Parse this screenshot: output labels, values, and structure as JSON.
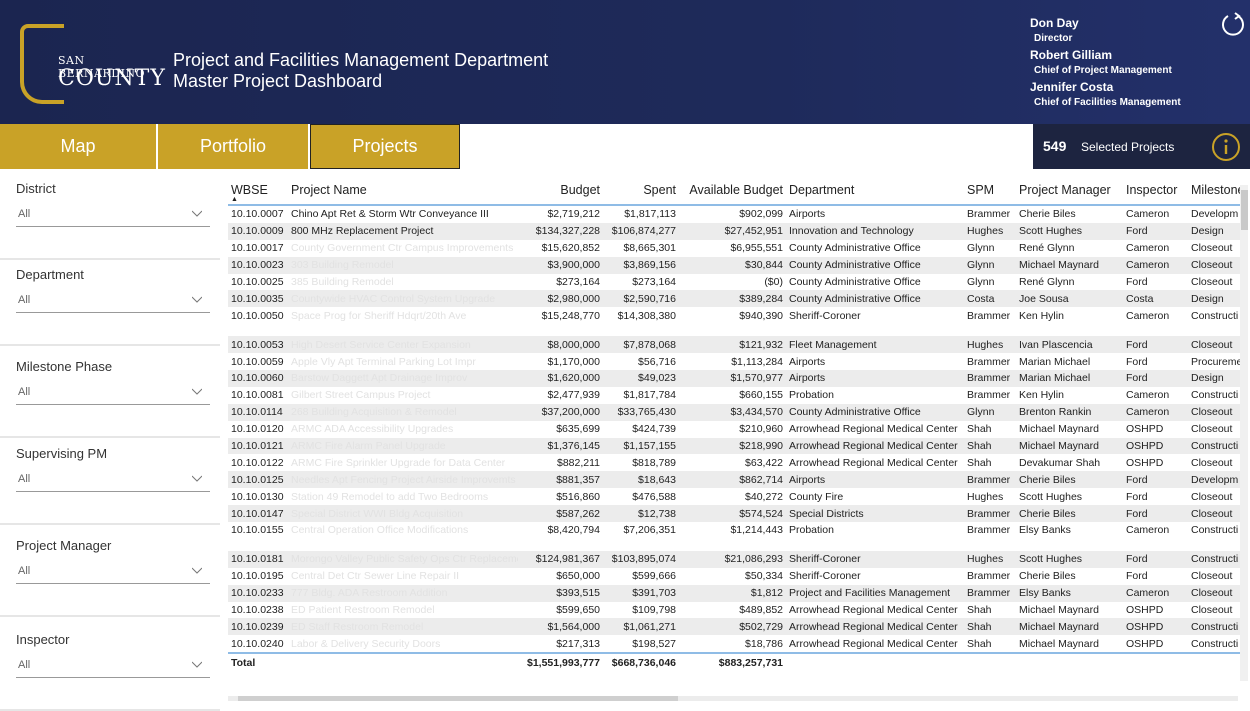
{
  "header": {
    "logo_top": "SAN BERNARDINO",
    "logo_bottom": "COUNTY",
    "title_line1": "Project and Facilities Management Department",
    "title_line2": "Master Project Dashboard",
    "staff": [
      {
        "name": "Don Day",
        "role": "Director"
      },
      {
        "name": "Robert Gilliam",
        "role": "Chief of Project Management"
      },
      {
        "name": "Jennifer Costa",
        "role": "Chief of Facilities Management"
      }
    ]
  },
  "nav": {
    "map": "Map",
    "portfolio": "Portfolio",
    "projects": "Projects"
  },
  "selection": {
    "count": "549",
    "label": "Selected Projects"
  },
  "filters": [
    {
      "label": "District",
      "value": "All"
    },
    {
      "label": "Department",
      "value": "All"
    },
    {
      "label": "Milestone Phase",
      "value": "All"
    },
    {
      "label": "Supervising PM",
      "value": "All"
    },
    {
      "label": "Project Manager",
      "value": "All"
    },
    {
      "label": "Inspector",
      "value": "All"
    }
  ],
  "table": {
    "columns": [
      "WBSE",
      "Project Name",
      "Budget",
      "Spent",
      "Available Budget",
      "Department",
      "SPM",
      "Project Manager",
      "Inspector",
      "Milestone"
    ],
    "rows": [
      [
        "10.10.0007",
        "Chino Apt Ret & Storm Wtr Conveyance III",
        "$2,719,212",
        "$1,817,113",
        "$902,099",
        "Airports",
        "Brammer",
        "Cherie Biles",
        "Cameron",
        "Developm"
      ],
      [
        "10.10.0009",
        "800 MHz Replacement Project",
        "$134,327,228",
        "$106,874,277",
        "$27,452,951",
        "Innovation and Technology",
        "Hughes",
        "Scott Hughes",
        "Ford",
        "Design"
      ],
      [
        "10.10.0017",
        "County Government Ctr Campus Improvements",
        "$15,620,852",
        "$8,665,301",
        "$6,955,551",
        "County Administrative Office",
        "Glynn",
        "René Glynn",
        "Cameron",
        "Closeout"
      ],
      [
        "10.10.0023",
        "303 Building Remodel",
        "$3,900,000",
        "$3,869,156",
        "$30,844",
        "County Administrative Office",
        "Glynn",
        "Michael Maynard",
        "Cameron",
        "Closeout"
      ],
      [
        "10.10.0025",
        "385 Building Remodel",
        "$273,164",
        "$273,164",
        "($0)",
        "County Administrative Office",
        "Glynn",
        "René Glynn",
        "Ford",
        "Closeout"
      ],
      [
        "10.10.0035",
        "Countywide HVAC Control System Upgrade",
        "$2,980,000",
        "$2,590,716",
        "$389,284",
        "County Administrative Office",
        "Costa",
        "Joe Sousa",
        "Costa",
        "Design"
      ],
      [
        "10.10.0050",
        "Space Prog for Sheriff Hdqrt/20th Ave",
        "$15,248,770",
        "$14,308,380",
        "$940,390",
        "Sheriff-Coroner",
        "Brammer",
        "Ken Hylin",
        "Cameron",
        "Constructi"
      ],
      [
        "",
        "",
        "",
        "",
        "",
        "",
        "",
        "",
        "",
        ""
      ],
      [
        "10.10.0053",
        "High Desert Service Center Expansion",
        "$8,000,000",
        "$7,878,068",
        "$121,932",
        "Fleet Management",
        "Hughes",
        "Ivan Plascencia",
        "Ford",
        "Closeout"
      ],
      [
        "10.10.0059",
        "Apple Vly Apt Terminal Parking Lot Impr",
        "$1,170,000",
        "$56,716",
        "$1,113,284",
        "Airports",
        "Brammer",
        "Marian Michael",
        "Ford",
        "Procureme"
      ],
      [
        "10.10.0060",
        "Barstow Daggett Apt Drainage Improv",
        "$1,620,000",
        "$49,023",
        "$1,570,977",
        "Airports",
        "Brammer",
        "Marian Michael",
        "Ford",
        "Design"
      ],
      [
        "10.10.0081",
        "Gilbert Street Campus Project",
        "$2,477,939",
        "$1,817,784",
        "$660,155",
        "Probation",
        "Brammer",
        "Ken Hylin",
        "Cameron",
        "Constructi"
      ],
      [
        "10.10.0114",
        "268 Building Acquisition & Remodel",
        "$37,200,000",
        "$33,765,430",
        "$3,434,570",
        "County Administrative Office",
        "Glynn",
        "Brenton Rankin",
        "Cameron",
        "Closeout"
      ],
      [
        "10.10.0120",
        "ARMC ADA Accessibility Upgrades",
        "$635,699",
        "$424,739",
        "$210,960",
        "Arrowhead Regional Medical Center",
        "Shah",
        "Michael Maynard",
        "OSHPD",
        "Closeout"
      ],
      [
        "10.10.0121",
        "ARMC Fire Alarm Panel Upgrade",
        "$1,376,145",
        "$1,157,155",
        "$218,990",
        "Arrowhead Regional Medical Center",
        "Shah",
        "Michael Maynard",
        "OSHPD",
        "Constructi"
      ],
      [
        "10.10.0122",
        "ARMC Fire Sprinkler Upgrade for Data Center",
        "$882,211",
        "$818,789",
        "$63,422",
        "Arrowhead Regional Medical Center",
        "Shah",
        "Devakumar Shah",
        "OSHPD",
        "Closeout"
      ],
      [
        "10.10.0125",
        "Needles Apt Fencing Project Airside Improvemts",
        "$881,357",
        "$18,643",
        "$862,714",
        "Airports",
        "Brammer",
        "Cherie Biles",
        "Ford",
        "Developm"
      ],
      [
        "10.10.0130",
        "Station 49 Remodel to add Two Bedrooms",
        "$516,860",
        "$476,588",
        "$40,272",
        "County Fire",
        "Hughes",
        "Scott Hughes",
        "Ford",
        "Closeout"
      ],
      [
        "10.10.0147",
        "Special District WWI Bldg Acquisition",
        "$587,262",
        "$12,738",
        "$574,524",
        "Special Districts",
        "Brammer",
        "Cherie Biles",
        "Ford",
        "Closeout"
      ],
      [
        "10.10.0155",
        "Central Operation Office Modifications",
        "$8,420,794",
        "$7,206,351",
        "$1,214,443",
        "Probation",
        "Brammer",
        "Elsy Banks",
        "Cameron",
        "Constructi"
      ],
      [
        "",
        "",
        "",
        "",
        "",
        "",
        "",
        "",
        "",
        ""
      ],
      [
        "10.10.0181",
        "Morongo Valley Public Safety Ops Ctr Replacement",
        "$124,981,367",
        "$103,895,074",
        "$21,086,293",
        "Sheriff-Coroner",
        "Hughes",
        "Scott Hughes",
        "Ford",
        "Constructi"
      ],
      [
        "10.10.0195",
        "Central Det Ctr Sewer Line Repair II",
        "$650,000",
        "$599,666",
        "$50,334",
        "Sheriff-Coroner",
        "Brammer",
        "Cherie Biles",
        "Ford",
        "Closeout"
      ],
      [
        "10.10.0233",
        "777 Bldg. ADA Restroom Addition",
        "$393,515",
        "$391,703",
        "$1,812",
        "Project and Facilities Management",
        "Brammer",
        "Elsy Banks",
        "Cameron",
        "Closeout"
      ],
      [
        "10.10.0238",
        "ED Patient Restroom Remodel",
        "$599,650",
        "$109,798",
        "$489,852",
        "Arrowhead Regional Medical Center",
        "Shah",
        "Michael Maynard",
        "OSHPD",
        "Closeout"
      ],
      [
        "10.10.0239",
        "ED Staff Restroom Remodel",
        "$1,564,000",
        "$1,061,271",
        "$502,729",
        "Arrowhead Regional Medical Center",
        "Shah",
        "Michael Maynard",
        "OSHPD",
        "Constructi"
      ],
      [
        "10.10.0240",
        "Labor & Delivery Security Doors",
        "$217,313",
        "$198,527",
        "$18,786",
        "Arrowhead Regional Medical Center",
        "Shah",
        "Michael Maynard",
        "OSHPD",
        "Constructi"
      ]
    ],
    "total": {
      "label": "Total",
      "budget": "$1,551,993,777",
      "spent": "$668,736,046",
      "available": "$883,257,731"
    }
  },
  "colors": {
    "header_bg": "#1e2a5a",
    "nav_gold": "#c9a227",
    "selected_bg": "#1d2440",
    "grid_accent": "#8fbce6"
  }
}
